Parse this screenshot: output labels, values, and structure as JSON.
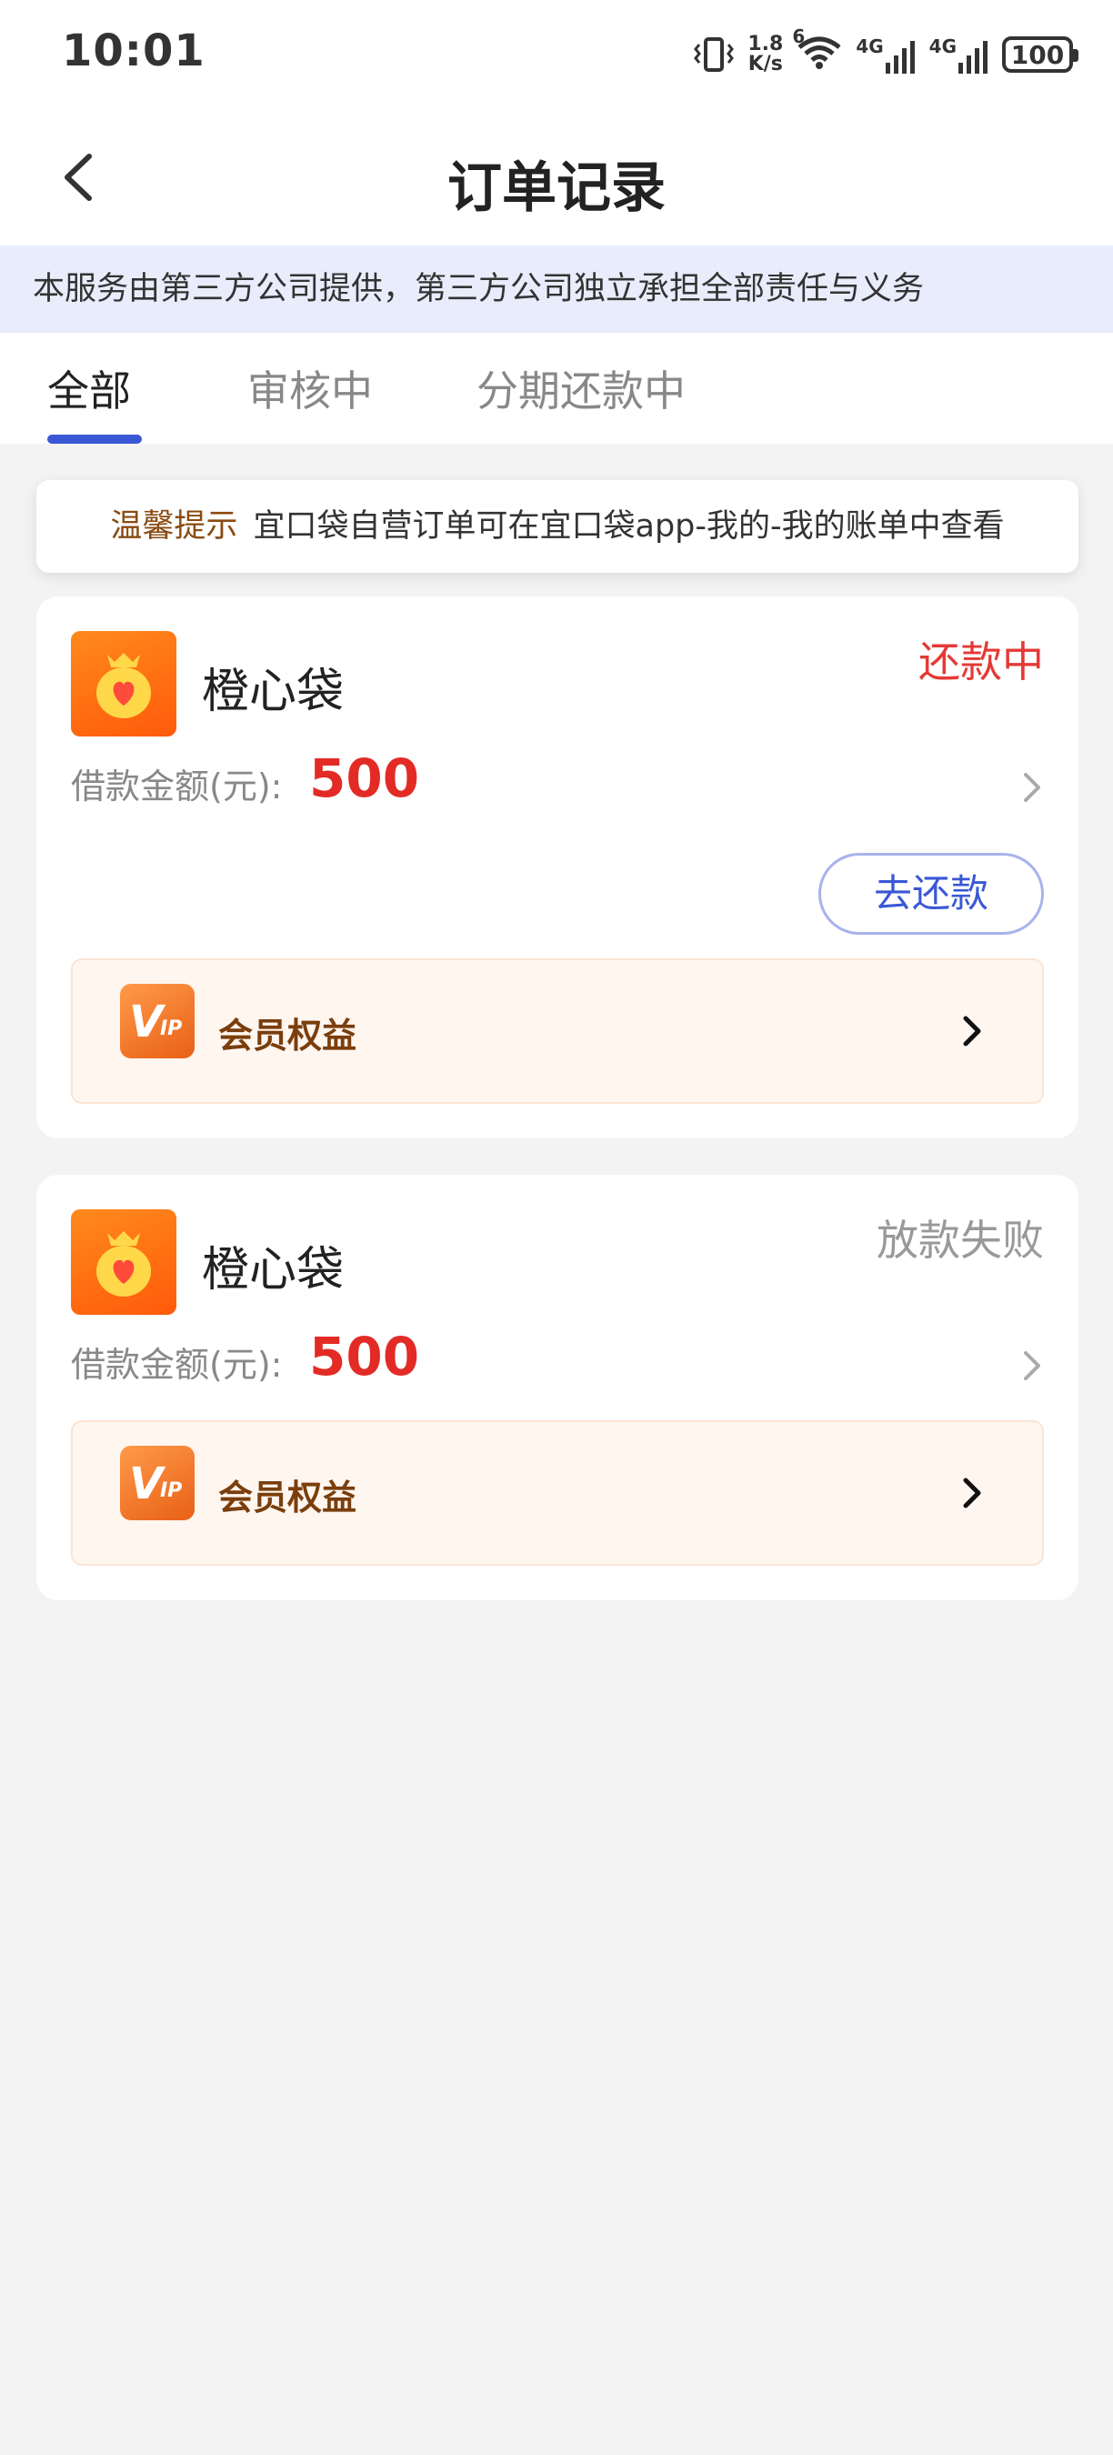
{
  "status_bar": {
    "time": "10:01",
    "net_speed_value": "1.8",
    "net_speed_unit": "K/s",
    "wifi_label": "6",
    "signal1_label": "4G",
    "signal2_label": "4G",
    "battery": "100"
  },
  "navbar": {
    "title": "订单记录"
  },
  "notice": {
    "text": "本服务由第三方公司提供，第三方公司独立承担全部责任与义务"
  },
  "tabs": [
    {
      "label": "全部",
      "active": true
    },
    {
      "label": "审核中",
      "active": false
    },
    {
      "label": "分期还款中",
      "active": false
    }
  ],
  "tip": {
    "label": "温馨提示",
    "text": "宜口袋自营订单可在宜口袋app-我的-我的账单中查看"
  },
  "orders": [
    {
      "app_name": "橙心袋",
      "status": "还款中",
      "status_color": "#e53935",
      "amount_label": "借款金额(元):",
      "amount": "500",
      "action_label": "去还款",
      "vip_label": "会员权益"
    },
    {
      "app_name": "橙心袋",
      "status": "放款失败",
      "status_color": "#999999",
      "amount_label": "借款金额(元):",
      "amount": "500",
      "vip_label": "会员权益"
    }
  ],
  "colors": {
    "accent": "#3a57d6",
    "amount_red": "#e32b26",
    "vip_bg": "#fff6f0"
  }
}
